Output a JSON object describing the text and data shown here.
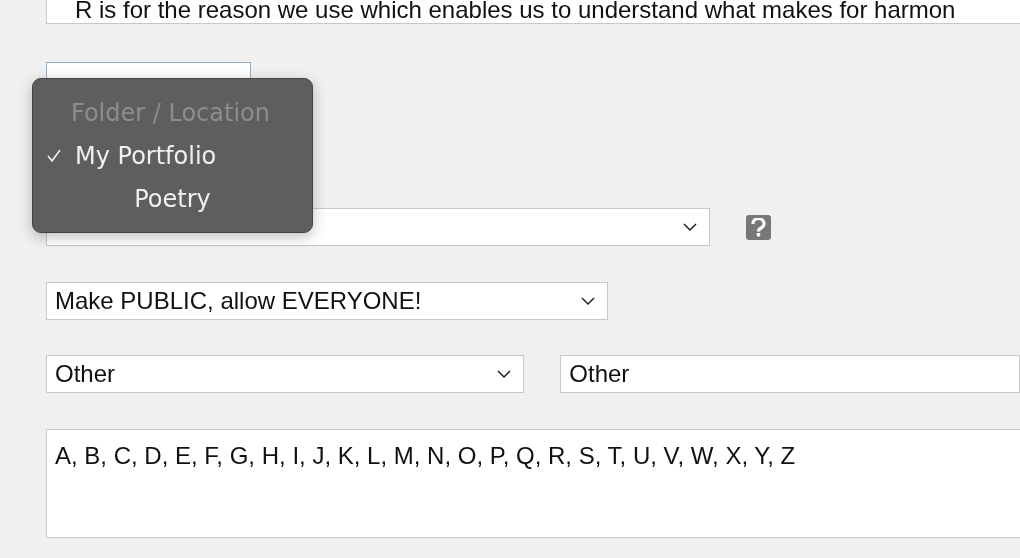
{
  "top_field": {
    "value": "R is for the reason we use which enables us to understand what makes for harmon"
  },
  "folder_select": {
    "expanded": true
  },
  "folder_menu": {
    "items": [
      {
        "label": "Folder / Location",
        "disabled": true,
        "checked": false
      },
      {
        "label": "My Portfolio",
        "disabled": false,
        "checked": true
      },
      {
        "label": "Poetry",
        "disabled": false,
        "checked": false
      }
    ]
  },
  "visibility_select": {
    "value": "Make PUBLIC, allow EVERYONE!"
  },
  "category_select": {
    "value": "Other"
  },
  "category_other_field": {
    "value": "Other"
  },
  "letters_area": {
    "value": "A, B, C, D, E, F, G, H, I, J, K, L, M, N, O, P, Q, R, S, T, U, V, W, X, Y, Z"
  }
}
